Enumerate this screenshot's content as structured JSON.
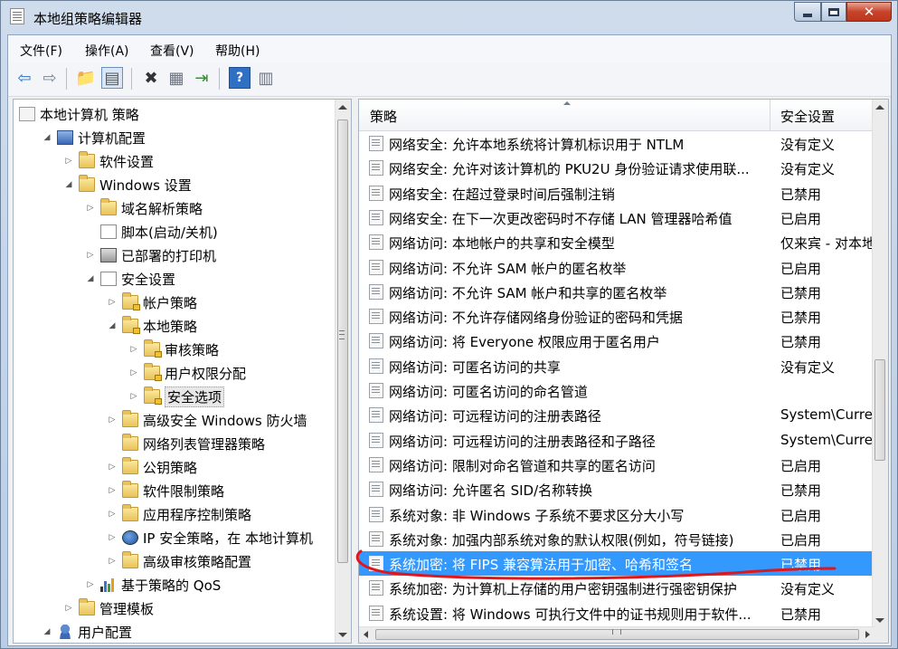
{
  "window": {
    "title": "本地组策略编辑器"
  },
  "menu": [
    {
      "label": "文件(F)"
    },
    {
      "label": "操作(A)"
    },
    {
      "label": "查看(V)"
    },
    {
      "label": "帮助(H)"
    }
  ],
  "tree": [
    {
      "label": "本地计算机 策略",
      "depth": 0,
      "toggle": "",
      "icon": "policy"
    },
    {
      "label": "计算机配置",
      "depth": 1,
      "toggle": "open",
      "icon": "computer"
    },
    {
      "label": "软件设置",
      "depth": 2,
      "toggle": "closed",
      "icon": "folder"
    },
    {
      "label": "Windows 设置",
      "depth": 2,
      "toggle": "open",
      "icon": "folder"
    },
    {
      "label": "域名解析策略",
      "depth": 3,
      "toggle": "closed",
      "icon": "folder"
    },
    {
      "label": "脚本(启动/关机)",
      "depth": 3,
      "toggle": "",
      "icon": "doc"
    },
    {
      "label": "已部署的打印机",
      "depth": 3,
      "toggle": "closed",
      "icon": "printer"
    },
    {
      "label": "安全设置",
      "depth": 3,
      "toggle": "open",
      "icon": "doc"
    },
    {
      "label": "帐户策略",
      "depth": 4,
      "toggle": "closed",
      "icon": "lockfolder"
    },
    {
      "label": "本地策略",
      "depth": 4,
      "toggle": "open",
      "icon": "lockfolder"
    },
    {
      "label": "审核策略",
      "depth": 5,
      "toggle": "closed",
      "icon": "lockfolder"
    },
    {
      "label": "用户权限分配",
      "depth": 5,
      "toggle": "closed",
      "icon": "lockfolder"
    },
    {
      "label": "安全选项",
      "depth": 5,
      "toggle": "closed",
      "icon": "lockfolder",
      "selected": true
    },
    {
      "label": "高级安全 Windows 防火墙",
      "depth": 4,
      "toggle": "closed",
      "icon": "folder"
    },
    {
      "label": "网络列表管理器策略",
      "depth": 4,
      "toggle": "",
      "icon": "folder"
    },
    {
      "label": "公钥策略",
      "depth": 4,
      "toggle": "closed",
      "icon": "folder"
    },
    {
      "label": "软件限制策略",
      "depth": 4,
      "toggle": "closed",
      "icon": "folder"
    },
    {
      "label": "应用程序控制策略",
      "depth": 4,
      "toggle": "closed",
      "icon": "folder"
    },
    {
      "label": "IP 安全策略，在 本地计算机",
      "depth": 4,
      "toggle": "closed",
      "icon": "shield"
    },
    {
      "label": "高级审核策略配置",
      "depth": 4,
      "toggle": "closed",
      "icon": "folder"
    },
    {
      "label": "基于策略的 QoS",
      "depth": 3,
      "toggle": "closed",
      "icon": "chart"
    },
    {
      "label": "管理模板",
      "depth": 2,
      "toggle": "closed",
      "icon": "folder"
    },
    {
      "label": "用户配置",
      "depth": 1,
      "toggle": "open",
      "icon": "user"
    }
  ],
  "list": {
    "columns": {
      "policy": "策略",
      "setting": "安全设置"
    },
    "rows": [
      {
        "policy": "网络安全: 允许本地系统将计算机标识用于 NTLM",
        "setting": "没有定义"
      },
      {
        "policy": "网络安全: 允许对该计算机的 PKU2U 身份验证请求使用联...",
        "setting": "没有定义"
      },
      {
        "policy": "网络安全: 在超过登录时间后强制注销",
        "setting": "已禁用"
      },
      {
        "policy": "网络安全: 在下一次更改密码时不存储 LAN 管理器哈希值",
        "setting": "已启用"
      },
      {
        "policy": "网络访问: 本地帐户的共享和安全模型",
        "setting": "仅来宾 - 对本地"
      },
      {
        "policy": "网络访问: 不允许 SAM 帐户的匿名枚举",
        "setting": "已启用"
      },
      {
        "policy": "网络访问: 不允许 SAM 帐户和共享的匿名枚举",
        "setting": "已禁用"
      },
      {
        "policy": "网络访问: 不允许存储网络身份验证的密码和凭据",
        "setting": "已禁用"
      },
      {
        "policy": "网络访问: 将 Everyone 权限应用于匿名用户",
        "setting": "已禁用"
      },
      {
        "policy": "网络访问: 可匿名访问的共享",
        "setting": "没有定义"
      },
      {
        "policy": "网络访问: 可匿名访问的命名管道",
        "setting": ""
      },
      {
        "policy": "网络访问: 可远程访问的注册表路径",
        "setting": "System\\Curren"
      },
      {
        "policy": "网络访问: 可远程访问的注册表路径和子路径",
        "setting": "System\\Curren"
      },
      {
        "policy": "网络访问: 限制对命名管道和共享的匿名访问",
        "setting": "已启用"
      },
      {
        "policy": "网络访问: 允许匿名 SID/名称转换",
        "setting": "已禁用"
      },
      {
        "policy": "系统对象: 非 Windows 子系统不要求区分大小写",
        "setting": "已启用"
      },
      {
        "policy": "系统对象: 加强内部系统对象的默认权限(例如，符号链接)",
        "setting": "已启用"
      },
      {
        "policy": "系统加密: 将 FIPS 兼容算法用于加密、哈希和签名",
        "setting": "已禁用",
        "selected": true
      },
      {
        "policy": "系统加密: 为计算机上存储的用户密钥强制进行强密钥保护",
        "setting": "没有定义"
      },
      {
        "policy": "系统设置: 将 Windows 可执行文件中的证书规则用于软件...",
        "setting": "已禁用"
      }
    ]
  },
  "annotation_color": "#e0161b",
  "selection_color": "#3399ff"
}
